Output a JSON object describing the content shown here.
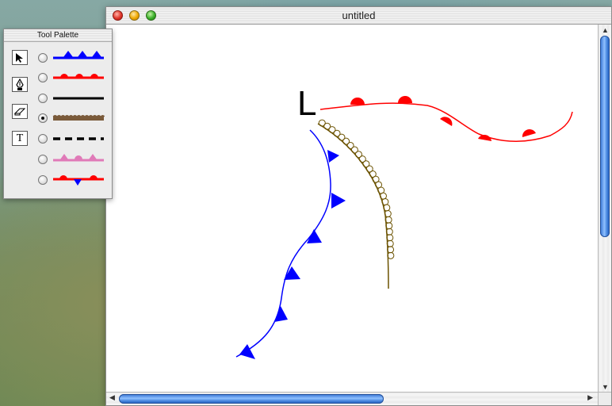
{
  "window": {
    "title": "untitled"
  },
  "palette": {
    "title": "Tool Palette",
    "tools": [
      {
        "name": "arrow-tool",
        "icon": "arrow-pointer-icon"
      },
      {
        "name": "pen-tool",
        "icon": "pen-nib-icon"
      },
      {
        "name": "eraser-tool",
        "icon": "eraser-icon"
      },
      {
        "name": "text-tool",
        "icon": "text-icon",
        "glyph": "T"
      }
    ],
    "line_styles": [
      {
        "name": "cold-front",
        "color": "#0000ff",
        "selected": false
      },
      {
        "name": "warm-front",
        "color": "#ff0000",
        "selected": false
      },
      {
        "name": "solid-black",
        "color": "#000000",
        "selected": false
      },
      {
        "name": "scalloped-brown",
        "color": "#7a5a3a",
        "selected": true
      },
      {
        "name": "dashed-black",
        "color": "#000000",
        "selected": false
      },
      {
        "name": "occluded-pink",
        "color": "#e07ab8",
        "selected": false
      },
      {
        "name": "stationary-front",
        "colors": [
          "#ff0000",
          "#0000ff"
        ],
        "selected": false
      }
    ]
  },
  "canvas": {
    "low_label": "L",
    "colors": {
      "cold_front": "#0000ff",
      "warm_front": "#ff0000",
      "scallop": "#6b5200"
    }
  }
}
